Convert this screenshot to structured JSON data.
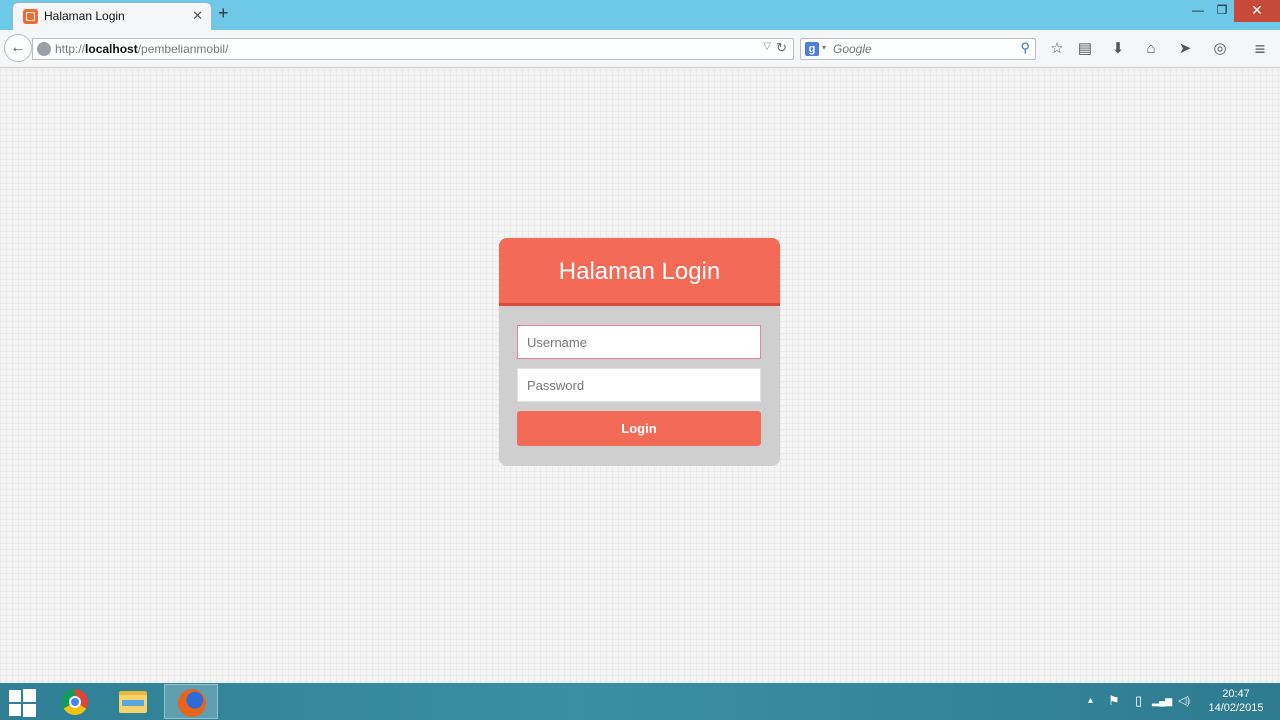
{
  "browser": {
    "tab_title": "Halaman Login",
    "tab_close": "✕",
    "new_tab": "+",
    "win_minimize": "—",
    "win_maximize": "❐",
    "win_close": "✕",
    "back": "←",
    "url_prefix": "http://",
    "url_host": "localhost",
    "url_path": "/pembelianmobil/",
    "url_dropdown": "▽",
    "reload": "↻",
    "search_engine_badge": "g",
    "search_dropdown": "▾",
    "search_placeholder": "Google",
    "search_go": "⚲",
    "toolbar": {
      "bookmark": "☆",
      "bookmarks_menu": "▤",
      "downloads": "⬇",
      "home": "⌂",
      "share": "➤",
      "sync": "◎",
      "menu": "≡"
    }
  },
  "login": {
    "title": "Halaman Login",
    "username_placeholder": "Username",
    "password_placeholder": "Password",
    "button_label": "Login"
  },
  "taskbar": {
    "tray_up": "▴",
    "tray_flag": "⚑",
    "tray_battery": "▯",
    "tray_signal": "▂▄▆",
    "tray_volume": "◁)",
    "time": "20:47",
    "date": "14/02/2015"
  },
  "colors": {
    "accent": "#f36b57",
    "titlebar": "#6ec9e8",
    "taskbar": "#2f7f95"
  }
}
